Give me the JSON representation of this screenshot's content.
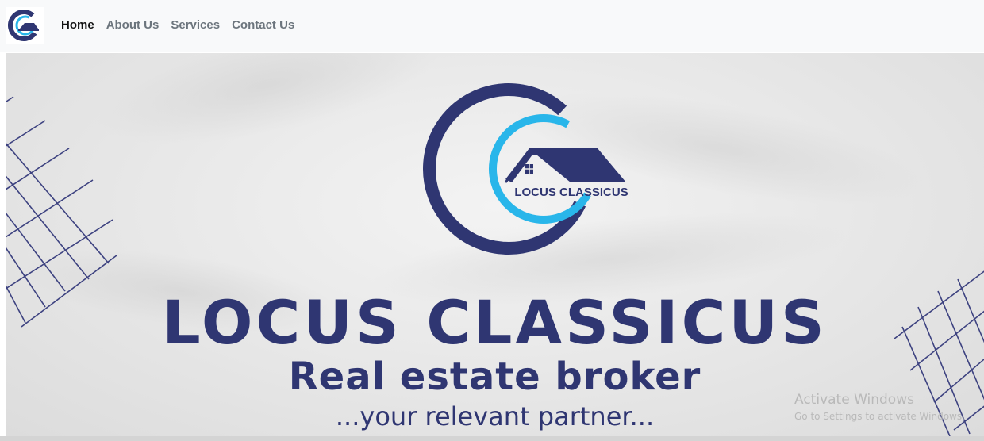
{
  "navbar": {
    "brand_icon": "locus-classicus-logo",
    "links": [
      {
        "label": "Home",
        "active": true
      },
      {
        "label": "About Us",
        "active": false
      },
      {
        "label": "Services",
        "active": false
      },
      {
        "label": "Contact Us",
        "active": false
      }
    ]
  },
  "hero": {
    "logo_text": "LOCUS CLASSICUS",
    "title": "LOCUS CLASSICUS",
    "subtitle": "Real estate broker",
    "tagline": "...your relevant partner..."
  },
  "watermark": {
    "title": "Activate Windows",
    "subtitle": "Go to Settings to activate Windows."
  },
  "colors": {
    "brand_navy": "#2f3672",
    "brand_cyan": "#29b6ea",
    "grid_lines": "#3d4280",
    "nav_active": "#111111",
    "nav_inactive": "#6c757d"
  }
}
